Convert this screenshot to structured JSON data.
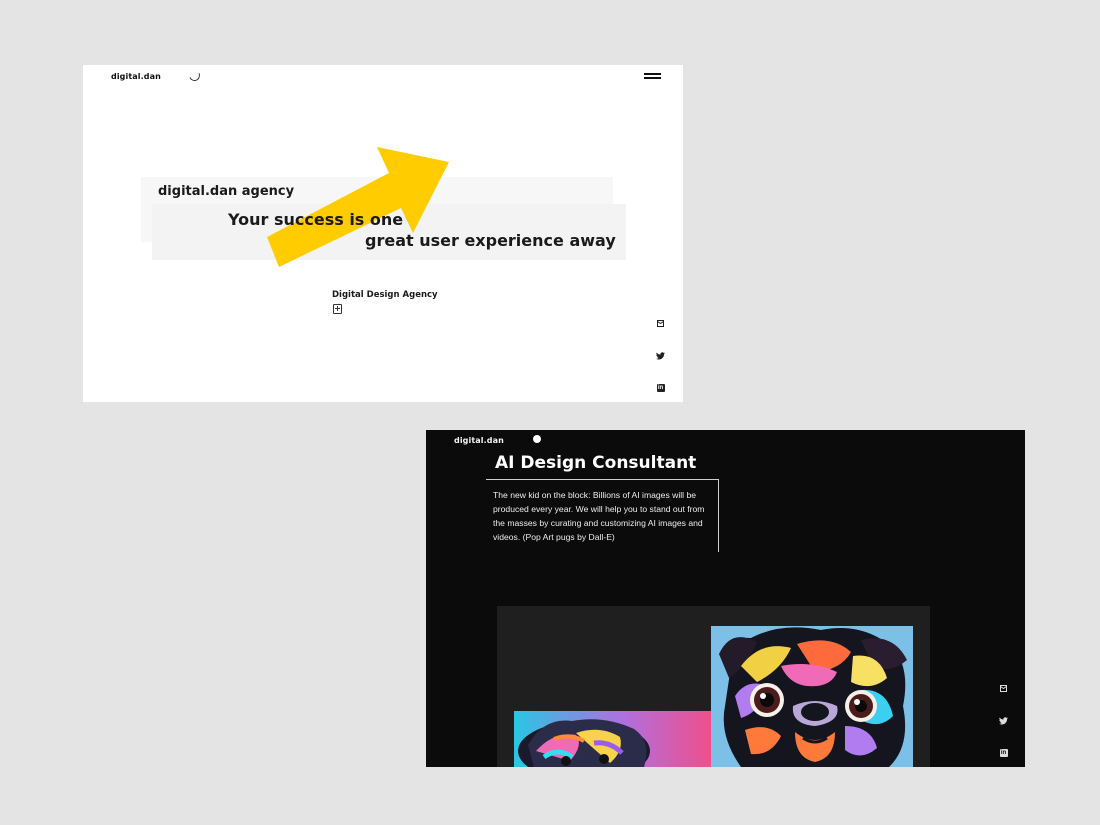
{
  "light_page": {
    "logo": "digital.dan",
    "hero": {
      "eyebrow": "digital.dan agency",
      "headline_line1": "Your success is one",
      "headline_line2": "great user experience away"
    },
    "subtitle": "Digital Design Agency",
    "social_icons": [
      "mail-icon",
      "twitter-icon",
      "linkedin-icon"
    ],
    "accent_color": "#ffcc00"
  },
  "dark_page": {
    "logo": "digital.dan",
    "title": "AI Design Consultant",
    "description": "The new kid on the block: Billions of AI images will be produced every year. We will help you to stand out from the masses by curating and customizing AI images and videos. (Pop Art pugs by Dall-E)",
    "social_icons": [
      "mail-icon",
      "twitter-icon",
      "linkedin-icon"
    ]
  }
}
